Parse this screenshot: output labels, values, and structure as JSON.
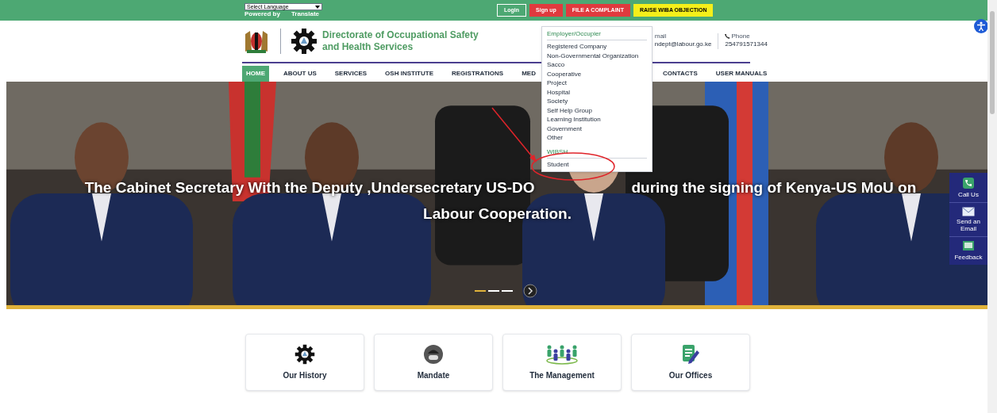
{
  "top_bar": {
    "language_select": {
      "value": "Select Language"
    },
    "powered_by": "Powered by",
    "translate": "Translate",
    "buttons": [
      {
        "label": "Login",
        "kind": "outline"
      },
      {
        "label": "Sign up",
        "kind": "red"
      },
      {
        "label": "FILE A COMPLAINT",
        "kind": "red"
      },
      {
        "label": "RAISE WIBA OBJECTION",
        "kind": "yellow"
      }
    ]
  },
  "header": {
    "title_lines": [
      "Directorate of Occupational Safety",
      "and Health Services"
    ],
    "contacts": [
      {
        "kind": "email",
        "label": "mail",
        "value": "ndept@labour.go.ke"
      },
      {
        "kind": "phone",
        "label": "Phone",
        "value": "254791571344"
      }
    ]
  },
  "nav": [
    {
      "label": "HOME",
      "selected": true,
      "kind": "item"
    },
    {
      "label": "ABOUT US",
      "selected": false,
      "kind": "item"
    },
    {
      "label": "SERVICES",
      "selected": false,
      "kind": "item"
    },
    {
      "label": "OSH INSTITUTE",
      "selected": false,
      "kind": "item"
    },
    {
      "label": "REGISTRATIONS",
      "selected": false,
      "kind": "item"
    },
    {
      "label": "MED",
      "selected": false,
      "kind": "cut"
    },
    {
      "label": "CONTACTS",
      "selected": false,
      "kind": "item"
    },
    {
      "label": "USER MANUALS",
      "selected": false,
      "kind": "item"
    }
  ],
  "dropdown": {
    "sections": [
      {
        "heading": "Employer/Occupier",
        "items": [
          "Registered Company",
          "Non-Governmental Organization",
          "Sacco",
          "Cooperative",
          "Project",
          "Hospital",
          "Society",
          "Self Help Group",
          "Learning Institution",
          "Government",
          "Other"
        ]
      },
      {
        "heading": "WIBSH",
        "items": [
          "Student"
        ]
      }
    ]
  },
  "hero": {
    "caption_left": "The Cabinet Secretary With the Deputy ,Undersecretary US-DO",
    "caption_right": "during the signing of Kenya-US MoU on",
    "caption_line2": "Labour Cooperation.",
    "slides": [
      {
        "selected": true
      },
      {
        "selected": false
      },
      {
        "selected": false
      }
    ]
  },
  "side_panel": [
    {
      "kind": "phone",
      "label": "Call Us"
    },
    {
      "kind": "email",
      "label": "Send an Email"
    },
    {
      "kind": "feedback",
      "label": "Feedback"
    }
  ],
  "cards": [
    {
      "kind": "gear",
      "label": "Our History"
    },
    {
      "kind": "mask",
      "label": "Mandate"
    },
    {
      "kind": "people",
      "label": "The Management"
    },
    {
      "kind": "notes",
      "label": "Our Offices"
    }
  ]
}
